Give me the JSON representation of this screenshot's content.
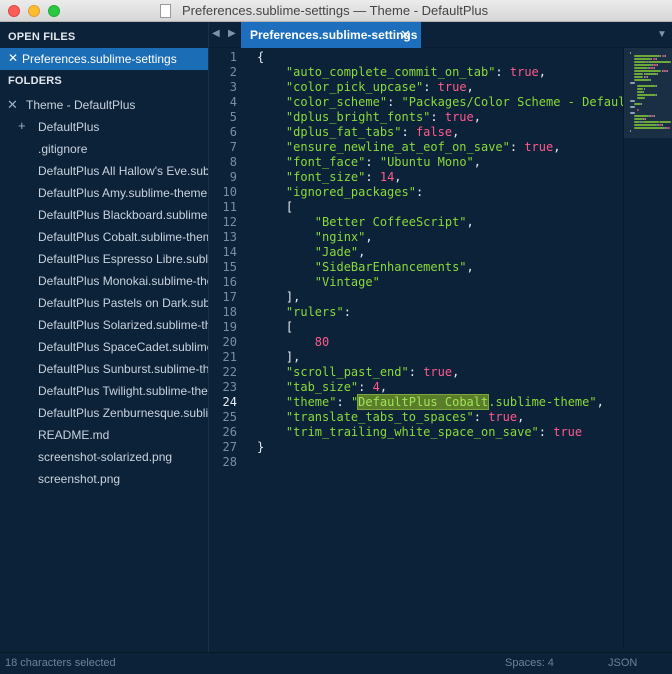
{
  "window": {
    "title": "Preferences.sublime-settings — Theme - DefaultPlus"
  },
  "sidebar": {
    "open_files_header": "OPEN FILES",
    "open_file": "Preferences.sublime-settings",
    "folders_header": "FOLDERS",
    "folder_name": "Theme - DefaultPlus",
    "items": [
      {
        "label": "DefaultPlus",
        "kind": "folder"
      },
      {
        "label": ".gitignore",
        "kind": "file"
      },
      {
        "label": "DefaultPlus All Hallow's Eve.sublime-theme",
        "kind": "file"
      },
      {
        "label": "DefaultPlus Amy.sublime-theme",
        "kind": "file"
      },
      {
        "label": "DefaultPlus Blackboard.sublime-theme",
        "kind": "file"
      },
      {
        "label": "DefaultPlus Cobalt.sublime-theme",
        "kind": "file"
      },
      {
        "label": "DefaultPlus Espresso Libre.sublime-theme",
        "kind": "file"
      },
      {
        "label": "DefaultPlus Monokai.sublime-theme",
        "kind": "file"
      },
      {
        "label": "DefaultPlus Pastels on Dark.sublime-theme",
        "kind": "file"
      },
      {
        "label": "DefaultPlus Solarized.sublime-theme",
        "kind": "file"
      },
      {
        "label": "DefaultPlus SpaceCadet.sublime-theme",
        "kind": "file"
      },
      {
        "label": "DefaultPlus Sunburst.sublime-theme",
        "kind": "file"
      },
      {
        "label": "DefaultPlus Twilight.sublime-theme",
        "kind": "file"
      },
      {
        "label": "DefaultPlus Zenburnesque.sublime-theme",
        "kind": "file"
      },
      {
        "label": "README.md",
        "kind": "file"
      },
      {
        "label": "screenshot-solarized.png",
        "kind": "file"
      },
      {
        "label": "screenshot.png",
        "kind": "file"
      }
    ]
  },
  "tabs": [
    {
      "label": "Preferences.sublime-settings",
      "active": true
    }
  ],
  "editor": {
    "current_line": 24,
    "lines": [
      [
        {
          "t": "{",
          "c": "p"
        }
      ],
      [
        {
          "t": "    ",
          "c": "p"
        },
        {
          "t": "\"auto_complete_commit_on_tab\"",
          "c": "str"
        },
        {
          "t": ": ",
          "c": "p"
        },
        {
          "t": "true",
          "c": "kw"
        },
        {
          "t": ",",
          "c": "p"
        }
      ],
      [
        {
          "t": "    ",
          "c": "p"
        },
        {
          "t": "\"color_pick_upcase\"",
          "c": "str"
        },
        {
          "t": ": ",
          "c": "p"
        },
        {
          "t": "true",
          "c": "kw"
        },
        {
          "t": ",",
          "c": "p"
        }
      ],
      [
        {
          "t": "    ",
          "c": "p"
        },
        {
          "t": "\"color_scheme\"",
          "c": "str"
        },
        {
          "t": ": ",
          "c": "p"
        },
        {
          "t": "\"Packages/Color Scheme - Default/",
          "c": "str"
        }
      ],
      [
        {
          "t": "    ",
          "c": "p"
        },
        {
          "t": "\"dplus_bright_fonts\"",
          "c": "str"
        },
        {
          "t": ": ",
          "c": "p"
        },
        {
          "t": "true",
          "c": "kw"
        },
        {
          "t": ",",
          "c": "p"
        }
      ],
      [
        {
          "t": "    ",
          "c": "p"
        },
        {
          "t": "\"dplus_fat_tabs\"",
          "c": "str"
        },
        {
          "t": ": ",
          "c": "p"
        },
        {
          "t": "false",
          "c": "kw"
        },
        {
          "t": ",",
          "c": "p"
        }
      ],
      [
        {
          "t": "    ",
          "c": "p"
        },
        {
          "t": "\"ensure_newline_at_eof_on_save\"",
          "c": "str"
        },
        {
          "t": ": ",
          "c": "p"
        },
        {
          "t": "true",
          "c": "kw"
        },
        {
          "t": ",",
          "c": "p"
        }
      ],
      [
        {
          "t": "    ",
          "c": "p"
        },
        {
          "t": "\"font_face\"",
          "c": "str"
        },
        {
          "t": ": ",
          "c": "p"
        },
        {
          "t": "\"Ubuntu Mono\"",
          "c": "str"
        },
        {
          "t": ",",
          "c": "p"
        }
      ],
      [
        {
          "t": "    ",
          "c": "p"
        },
        {
          "t": "\"font_size\"",
          "c": "str"
        },
        {
          "t": ": ",
          "c": "p"
        },
        {
          "t": "14",
          "c": "num"
        },
        {
          "t": ",",
          "c": "p"
        }
      ],
      [
        {
          "t": "    ",
          "c": "p"
        },
        {
          "t": "\"ignored_packages\"",
          "c": "str"
        },
        {
          "t": ":",
          "c": "p"
        }
      ],
      [
        {
          "t": "    [",
          "c": "p"
        }
      ],
      [
        {
          "t": "        ",
          "c": "p"
        },
        {
          "t": "\"Better CoffeeScript\"",
          "c": "str"
        },
        {
          "t": ",",
          "c": "p"
        }
      ],
      [
        {
          "t": "        ",
          "c": "p"
        },
        {
          "t": "\"nginx\"",
          "c": "str"
        },
        {
          "t": ",",
          "c": "p"
        }
      ],
      [
        {
          "t": "        ",
          "c": "p"
        },
        {
          "t": "\"Jade\"",
          "c": "str"
        },
        {
          "t": ",",
          "c": "p"
        }
      ],
      [
        {
          "t": "        ",
          "c": "p"
        },
        {
          "t": "\"SideBarEnhancements\"",
          "c": "str"
        },
        {
          "t": ",",
          "c": "p"
        }
      ],
      [
        {
          "t": "        ",
          "c": "p"
        },
        {
          "t": "\"Vintage\"",
          "c": "str"
        }
      ],
      [
        {
          "t": "    ],",
          "c": "p"
        }
      ],
      [
        {
          "t": "    ",
          "c": "p"
        },
        {
          "t": "\"rulers\"",
          "c": "str"
        },
        {
          "t": ":",
          "c": "p"
        }
      ],
      [
        {
          "t": "    [",
          "c": "p"
        }
      ],
      [
        {
          "t": "        ",
          "c": "p"
        },
        {
          "t": "80",
          "c": "num"
        }
      ],
      [
        {
          "t": "    ],",
          "c": "p"
        }
      ],
      [
        {
          "t": "    ",
          "c": "p"
        },
        {
          "t": "\"scroll_past_end\"",
          "c": "str"
        },
        {
          "t": ": ",
          "c": "p"
        },
        {
          "t": "true",
          "c": "kw"
        },
        {
          "t": ",",
          "c": "p"
        }
      ],
      [
        {
          "t": "    ",
          "c": "p"
        },
        {
          "t": "\"tab_size\"",
          "c": "str"
        },
        {
          "t": ": ",
          "c": "p"
        },
        {
          "t": "4",
          "c": "num"
        },
        {
          "t": ",",
          "c": "p"
        }
      ],
      [
        {
          "t": "    ",
          "c": "p"
        },
        {
          "t": "\"theme\"",
          "c": "str"
        },
        {
          "t": ": ",
          "c": "p"
        },
        {
          "t": "\"",
          "c": "str"
        },
        {
          "t": "DefaultPlus Cobalt",
          "c": "hl"
        },
        {
          "t": ".sublime-theme\"",
          "c": "str"
        },
        {
          "t": ",",
          "c": "p"
        }
      ],
      [
        {
          "t": "    ",
          "c": "p"
        },
        {
          "t": "\"translate_tabs_to_spaces\"",
          "c": "str"
        },
        {
          "t": ": ",
          "c": "p"
        },
        {
          "t": "true",
          "c": "kw"
        },
        {
          "t": ",",
          "c": "p"
        }
      ],
      [
        {
          "t": "    ",
          "c": "p"
        },
        {
          "t": "\"trim_trailing_white_space_on_save\"",
          "c": "str"
        },
        {
          "t": ": ",
          "c": "p"
        },
        {
          "t": "true",
          "c": "kw"
        }
      ],
      [
        {
          "t": "}",
          "c": "p"
        }
      ],
      []
    ]
  },
  "status": {
    "selection": "18 characters selected",
    "indent": "Spaces: 4",
    "syntax": "JSON"
  },
  "colors": {
    "background": "#0c2238",
    "accent_blue": "#1d6fbe",
    "string_green": "#8ad93b",
    "keyword_pink": "#ff5a8c"
  },
  "icons": {
    "close": "close-icon",
    "expand": "plus-icon",
    "nav_left": "triangle-left-icon",
    "nav_right": "triangle-right-icon",
    "tab_menu": "triangle-down-icon"
  }
}
